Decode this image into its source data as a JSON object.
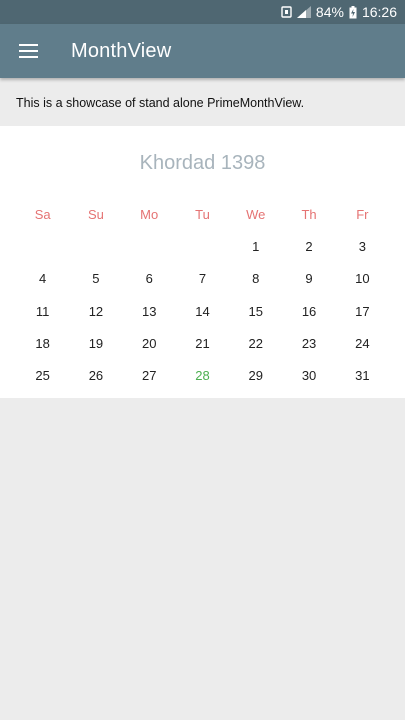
{
  "status_bar": {
    "battery": "84%",
    "time": "16:26"
  },
  "app_bar": {
    "title": "MonthView",
    "menu_icon": "hamburger-menu-icon"
  },
  "description": "This is a showcase of stand alone PrimeMonthView.",
  "calendar": {
    "month_title": "Khordad 1398",
    "weekdays": [
      "Sa",
      "Su",
      "Mo",
      "Tu",
      "We",
      "Th",
      "Fr"
    ],
    "weeks": [
      [
        "",
        "",
        "",
        "",
        "1",
        "2",
        "3"
      ],
      [
        "4",
        "5",
        "6",
        "7",
        "8",
        "9",
        "10"
      ],
      [
        "11",
        "12",
        "13",
        "14",
        "15",
        "16",
        "17"
      ],
      [
        "18",
        "19",
        "20",
        "21",
        "22",
        "23",
        "24"
      ],
      [
        "25",
        "26",
        "27",
        "28",
        "29",
        "30",
        "31"
      ]
    ],
    "today": "28"
  },
  "colors": {
    "appbar": "#607d8b",
    "statusbar": "#4f6772",
    "weekday": "#e57373",
    "today": "#4caf50",
    "month_title": "#a8b4bc"
  }
}
